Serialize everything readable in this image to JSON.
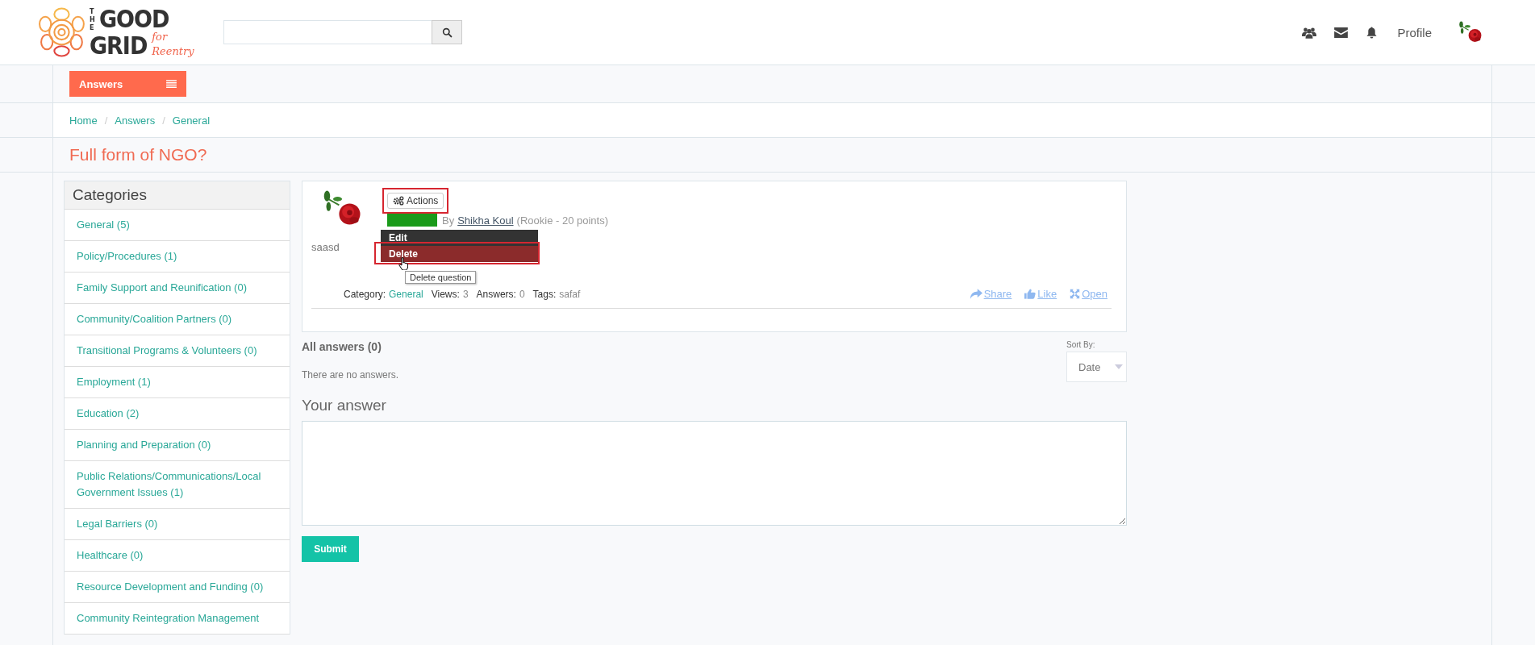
{
  "header": {
    "logo": {
      "prefix": "THE",
      "line1": "GOOD",
      "line2": "GRID",
      "tagline": "for Reentry"
    },
    "profile_label": "Profile"
  },
  "menu_button": "Answers",
  "breadcrumb": {
    "separator": "/",
    "items": [
      "Home",
      "Answers",
      "General"
    ]
  },
  "page_title": "Full form of NGO?",
  "categories": {
    "title": "Categories",
    "items": [
      {
        "label": "General (5)"
      },
      {
        "label": "Policy/Procedures (1)"
      },
      {
        "label": "Family Support and Reunification (0)"
      },
      {
        "label": "Community/Coalition Partners (0)"
      },
      {
        "label": "Transitional Programs & Volunteers (0)"
      },
      {
        "label": "Employment (1)"
      },
      {
        "label": "Education (2)"
      },
      {
        "label": "Planning and Preparation (0)"
      },
      {
        "label": "Public Relations/Communications/Local Government Issues (1)"
      },
      {
        "label": "Legal Barriers (0)"
      },
      {
        "label": "Healthcare (0)"
      },
      {
        "label": "Resource Development and Funding (0)"
      },
      {
        "label": "Community Reintegration Management"
      }
    ]
  },
  "question": {
    "actions": {
      "label": "Actions",
      "highlighted": true
    },
    "author_prefix": "By",
    "author": "Shikha Koul",
    "author_rank": "(Rookie - 20 points)",
    "body": "saasd",
    "meta": [
      {
        "label": "Category:",
        "value": "General",
        "kind": "link"
      },
      {
        "label": "Views:",
        "value": "3",
        "kind": "text"
      },
      {
        "label": "Answers:",
        "value": "0",
        "kind": "text"
      },
      {
        "label": "Tags:",
        "value": "safaf",
        "kind": "text"
      }
    ],
    "links": [
      {
        "label": "Share",
        "kind": "share"
      },
      {
        "label": "Like",
        "kind": "like"
      },
      {
        "label": "Open",
        "kind": "open"
      }
    ]
  },
  "actions_menu": {
    "items": [
      {
        "label": "Edit",
        "selected": false,
        "highlighted": false
      },
      {
        "label": "Delete",
        "selected": true,
        "highlighted": true
      }
    ],
    "tooltip": "Delete question"
  },
  "answers": {
    "heading": "All answers (0)",
    "empty_text": "There are no answers.",
    "sort_label": "Sort By:",
    "sort_value": "Date"
  },
  "compose": {
    "heading": "Your answer",
    "submit": "Submit"
  }
}
